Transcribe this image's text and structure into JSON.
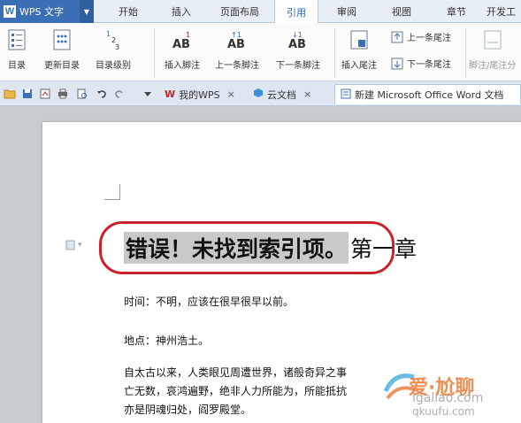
{
  "app": {
    "title": "WPS 文字",
    "logo_text": "W"
  },
  "menu_tabs": [
    "开始",
    "插入",
    "页面布局",
    "引用",
    "审阅",
    "视图",
    "章节",
    "开发工"
  ],
  "ribbon": {
    "toc_label": "目录",
    "update_toc_label": "更新目录",
    "toc_level_label": "目录级别",
    "insert_footnote_label": "插入脚注",
    "prev_footnote_label": "上一条脚注",
    "next_footnote_label": "下一条脚注",
    "insert_endnote_label": "插入尾注",
    "prev_endnote_label": "上一条尾注",
    "next_endnote_label": "下一条尾注",
    "footnote_endnote_label": "脚注/尾注分"
  },
  "doc_tabs": {
    "my_wps": "我的WPS",
    "cloud_docs": "云文档",
    "current_doc": "新建 Microsoft Office Word 文档"
  },
  "document": {
    "heading_error": "错误！未找到索引项。",
    "heading_chapter": "第一章",
    "line1": "时间：不明，应该在很早很早以前。",
    "line2": "地点：神州浩土。",
    "line3": "自太古以来，人类眼见周遭世界，诸般奇异之事",
    "line4": "亡无数，哀鸿遍野，绝非人力所能为，所能抵抗",
    "line5": "亦是阴魂归处，阎罗殿堂。"
  },
  "watermark": {
    "text": "爱·尬聊",
    "url": "igaliao.com",
    "url2": "qkuufu.com"
  },
  "colors": {
    "wps_blue": "#3a6fb6",
    "highlight_ring": "#c8232b",
    "watermark_orange": "#e86a1c"
  }
}
